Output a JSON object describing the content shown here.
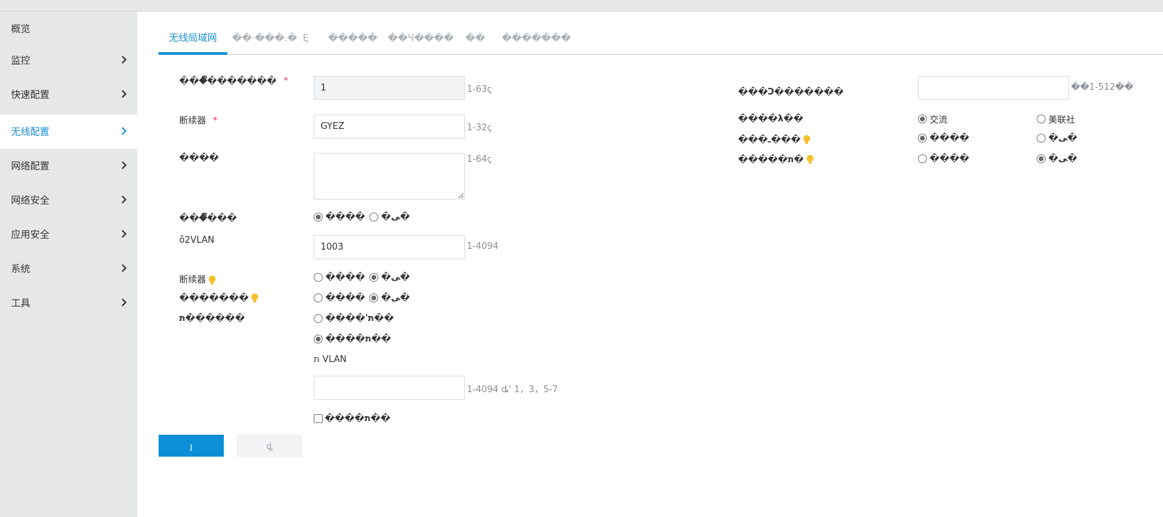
{
  "sidebar": {
    "items": [
      {
        "label": "概览"
      },
      {
        "label": "监控"
      },
      {
        "label": "快速配置"
      },
      {
        "label": "无线配置"
      },
      {
        "label": "网络配置"
      },
      {
        "label": "网络安全"
      },
      {
        "label": "应用安全"
      },
      {
        "label": "系统"
      },
      {
        "label": "工具"
      }
    ]
  },
  "tabs": [
    {
      "label": "无线局域网"
    },
    {
      "label": "��·���.�"
    },
    {
      "label": "Ę"
    },
    {
      "label": "�����"
    },
    {
      "label": "��Ч����"
    },
    {
      "label": "��"
    },
    {
      "label": "�������"
    }
  ],
  "form": {
    "wlan_id": {
      "label": "���ී�������",
      "value": "1",
      "hint": "1-63ꞔ"
    },
    "ssid": {
      "label": "断续器",
      "value": "GYEZ",
      "hint": "1-32ꞔ"
    },
    "description": {
      "label": "����",
      "value": "",
      "hint": "1-64ꞔ"
    },
    "wlan_status": {
      "label": "���ී���",
      "options": [
        "����",
        "�ﻰ�"
      ],
      "selected": 0
    },
    "vlan": {
      "label": "ȍ2VLAN",
      "value": "1003",
      "hint": "1-4094"
    },
    "broadcast": {
      "label": "断续器",
      "options": [
        "����",
        "�ﻰ�"
      ],
      "selected": 1
    },
    "isolation": {
      "label": "�������",
      "options": [
        "����",
        "�ﻰ�"
      ],
      "selected": 1
    },
    "mode": {
      "label": "ת������",
      "options": [
        "����'ת��",
        "����ת��"
      ],
      "selected": 1
    },
    "forward_vlan": {
      "label": "ת VLAN",
      "value": "",
      "hint": "1-4094 ȡ' 1，3，5-7"
    },
    "check_option": {
      "label": "����ת��"
    },
    "max_users": {
      "label": "���Ͻ�������",
      "value": "",
      "hint": "��1-512��"
    },
    "traffic": {
      "label": "����λ��",
      "options": [
        "交流",
        "美联社"
      ],
      "selected": 0
    },
    "opt_a": {
      "label": "���ـ���",
      "options": [
        "����",
        "�ﻰ�"
      ],
      "selected": 0
    },
    "opt_b": {
      "label": "�����ת�",
      "options": [
        "����",
        "�ﻰ�"
      ],
      "selected": 1
    }
  },
  "buttons": {
    "submit": "ȷ",
    "cancel": "ȡ"
  },
  "colors": {
    "accent": "#1a8fd6",
    "primary_button": "#0d8fd8",
    "sidebar_bg": "#e6e8e8",
    "required": "#e0313f",
    "bulb": "#f5c02c"
  }
}
